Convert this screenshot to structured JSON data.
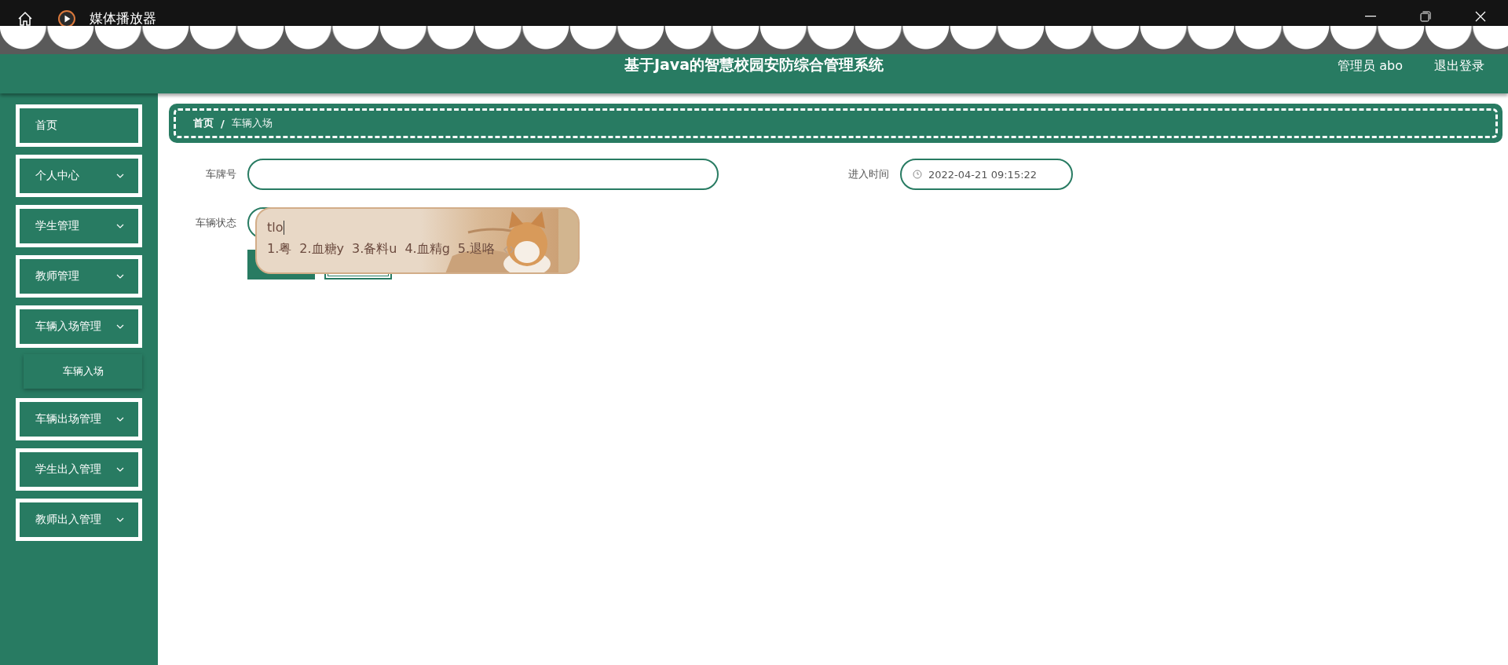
{
  "window": {
    "title": "媒体播放器"
  },
  "header": {
    "title": "基于Java的智慧校园安防综合管理系统",
    "user": "管理员 abo",
    "logout": "退出登录"
  },
  "sidebar": {
    "items": [
      {
        "label": "首页",
        "kind": "link"
      },
      {
        "label": "个人中心",
        "kind": "menu"
      },
      {
        "label": "学生管理",
        "kind": "menu"
      },
      {
        "label": "教师管理",
        "kind": "menu"
      },
      {
        "label": "车辆入场管理",
        "kind": "menu",
        "children": [
          {
            "label": "车辆入场"
          }
        ]
      },
      {
        "label": "车辆出场管理",
        "kind": "menu"
      },
      {
        "label": "学生出入管理",
        "kind": "menu"
      },
      {
        "label": "教师出入管理",
        "kind": "menu"
      }
    ]
  },
  "breadcrumb": {
    "separator": "/",
    "items": [
      {
        "label": "首页",
        "current": false
      },
      {
        "label": "车辆入场",
        "current": true
      }
    ]
  },
  "form": {
    "fields": [
      {
        "kind": "text",
        "label": "车牌号"
      },
      {
        "kind": "datetime",
        "label": "进入时间",
        "value": "2022-04-21 09:15:22"
      },
      {
        "kind": "select",
        "label": "车辆状态"
      }
    ],
    "buttons": [
      {
        "kind": "primary"
      },
      {
        "kind": "secondary"
      }
    ]
  },
  "ime": {
    "input": "tlo",
    "candidates": [
      "1.粤",
      "2.血糖y",
      "3.备料u",
      "4.血精g",
      "5.退咯"
    ]
  }
}
